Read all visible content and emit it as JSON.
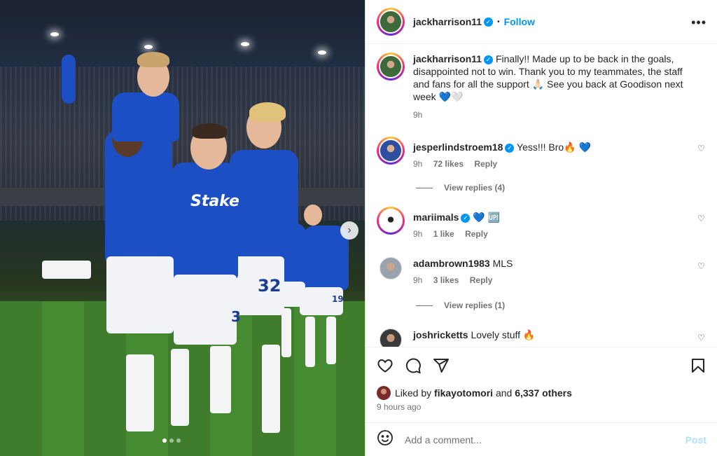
{
  "post": {
    "author": "jackharrison11",
    "follow_label": "Follow",
    "separator": "•",
    "more_label": "•••",
    "caption": "Finally!! Made up to be back in the goals, disappointed not to win. Thank you to my teammates, the staff and fans for all the support 🙏🏻 See you back at Goodison next week 💙🤍",
    "caption_time": "9h"
  },
  "photo": {
    "shirt_sponsor": "Stake",
    "numbers": [
      "32",
      "19",
      "3"
    ],
    "colors": {
      "kit_blue": "#1d4fc4",
      "pitch_green": "#468a31"
    }
  },
  "comments": [
    {
      "user": "jesperlindstroem18",
      "verified": true,
      "text": "Yess!!! Bro🔥 💙",
      "time": "9h",
      "likes": "72 likes",
      "reply": "Reply",
      "replies": "View replies (4)"
    },
    {
      "user": "mariimals",
      "verified": true,
      "text": "💙 🆙",
      "time": "9h",
      "likes": "1 like",
      "reply": "Reply"
    },
    {
      "user": "adambrown1983",
      "verified": false,
      "text": "MLS",
      "time": "9h",
      "likes": "3 likes",
      "reply": "Reply",
      "replies": "View replies (1)"
    },
    {
      "user": "joshricketts",
      "verified": false,
      "text": "Lovely stuff 🔥"
    }
  ],
  "actions": {
    "like_icon": "heart-icon",
    "comment_icon": "comment-icon",
    "share_icon": "send-icon",
    "save_icon": "bookmark-icon"
  },
  "likes": {
    "prefix": "Liked by",
    "user": "fikayotomori",
    "joiner": "and",
    "others": "6,337 others"
  },
  "time_ago": "9 hours ago",
  "add_comment": {
    "placeholder": "Add a comment...",
    "post_label": "Post"
  },
  "colors": {
    "accent": "#0095f6",
    "post_disabled": "#b2dffc",
    "secondary_text": "#737373"
  }
}
